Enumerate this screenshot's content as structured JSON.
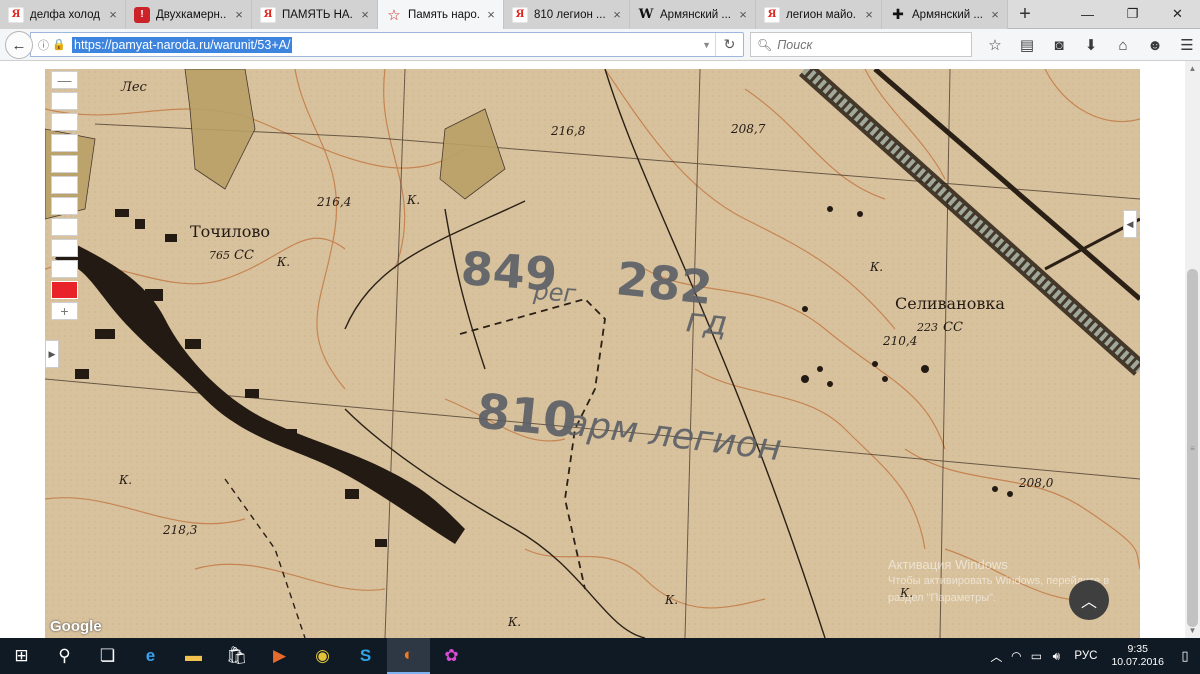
{
  "browser": {
    "tabs": [
      {
        "label": "делфа холод...",
        "favicon": "yandex-icon",
        "active": false
      },
      {
        "label": "Двухкамерн...",
        "favicon": "shop-icon",
        "active": false
      },
      {
        "label": "ПАМЯТЬ НА...",
        "favicon": "yandex-icon",
        "active": false
      },
      {
        "label": "Память наро...",
        "favicon": "star-icon",
        "active": true
      },
      {
        "label": "810 легион ...",
        "favicon": "yandex-icon",
        "active": false
      },
      {
        "label": "Армянский ...",
        "favicon": "wikipedia-icon",
        "active": false
      },
      {
        "label": "легион майо...",
        "favicon": "yandex-icon",
        "active": false
      },
      {
        "label": "Армянский ...",
        "favicon": "cross-icon",
        "active": false
      }
    ],
    "url": "https://pamyat-naroda.ru/warunit/53+A/",
    "search_placeholder": "Поиск"
  },
  "map": {
    "place_labels": {
      "les": "Лес",
      "tochilovo": "Точилово",
      "tochilovo_num": "765",
      "tochilovo_cc": "СС",
      "selivanovka": "Селивановка",
      "selivanovka_num": "223",
      "selivanovka_cc": "СС",
      "k": "К."
    },
    "elevations": [
      "216,8",
      "208,7",
      "216,4",
      "210,4",
      "218,3",
      "208,0"
    ],
    "annotations": {
      "line1_a": "849",
      "line1_b": "рег",
      "line1_c": "282",
      "line1_d": "гд",
      "line2_a": "810",
      "line2_b": "арм легион"
    },
    "google": "Google",
    "watermark_line1": "Активация Windows",
    "watermark_line2": "Чтобы активировать Windows, перейдите в",
    "watermark_line3": "раздел \"Параметры\"."
  },
  "taskbar": {
    "lang": "РУС",
    "time": "9:35",
    "date": "10.07.2016"
  }
}
